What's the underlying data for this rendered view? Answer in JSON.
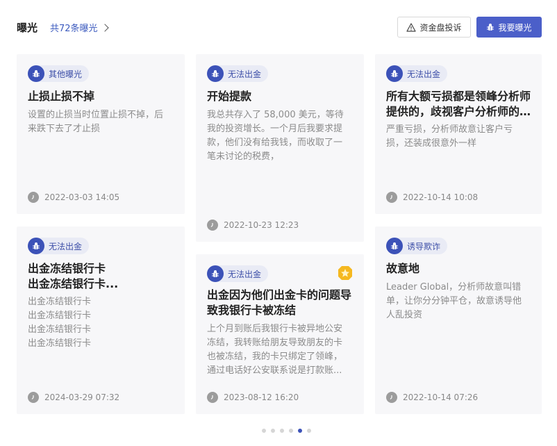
{
  "header": {
    "title": "曝光",
    "count_link": "共72条曝光",
    "complaint_button": "资金盘投诉",
    "expose_button": "我要曝光"
  },
  "cards": [
    {
      "tag": "其他曝光",
      "title": "止损止损不掉",
      "body_lines": [
        "设置的止损当时位置止损不掉，后",
        "来跌下去了才止损"
      ],
      "date": "2022-03-03 14:05"
    },
    {
      "tag": "无法出金",
      "title": "开始提款",
      "body_lines": [
        "我总共存入了 58,000 美元，等待",
        "我的投资增长。一个月后我要求提",
        "款，他们没有给我钱，而收取了一",
        "笔未讨论的税费，"
      ],
      "date": "2022-10-23 12:23"
    },
    {
      "tag": "无法出金",
      "title_lines": [
        "所有大额亏损都是领峰分析师",
        "提供的，歧视客户分析师的..."
      ],
      "body_lines": [
        "严重亏损，分析师故意让客户亏",
        "损，还装成很意外一样"
      ],
      "date": "2022-10-14 10:08"
    },
    {
      "tag": "无法出金",
      "title_lines": [
        "出金冻结银行卡",
        "出金冻结银行卡..."
      ],
      "body_lines": [
        "出金冻结银行卡",
        "出金冻结银行卡",
        "出金冻结银行卡",
        "出金冻结银行卡"
      ],
      "date": "2024-03-29 07:32"
    },
    {
      "tag": "无法出金",
      "title_lines": [
        "出金因为他们出金卡的问题导",
        "致我银行卡被冻结"
      ],
      "body_lines": [
        "上个月到账后我银行卡被异地公安",
        "冻结，我转账给朋友导致朋友的卡",
        "也被冻结，我的卡只绑定了领峰，",
        "通过电话好公安联系说是打款账..."
      ],
      "date": "2023-08-12 16:20"
    },
    {
      "tag": "诱导欺诈",
      "title": "故意地",
      "body_lines": [
        "Leader Global，分析师故意叫错",
        "单，让你分分钟平仓，故意诱导他",
        "人乱投资"
      ],
      "date": "2022-10-14 07:26"
    }
  ],
  "pagination": {
    "total": 6,
    "active_index": 4
  },
  "colors": {
    "accent": "#4b5fc9",
    "tag_bg": "#e9ebf5",
    "card_bg": "#f7f7f9"
  }
}
